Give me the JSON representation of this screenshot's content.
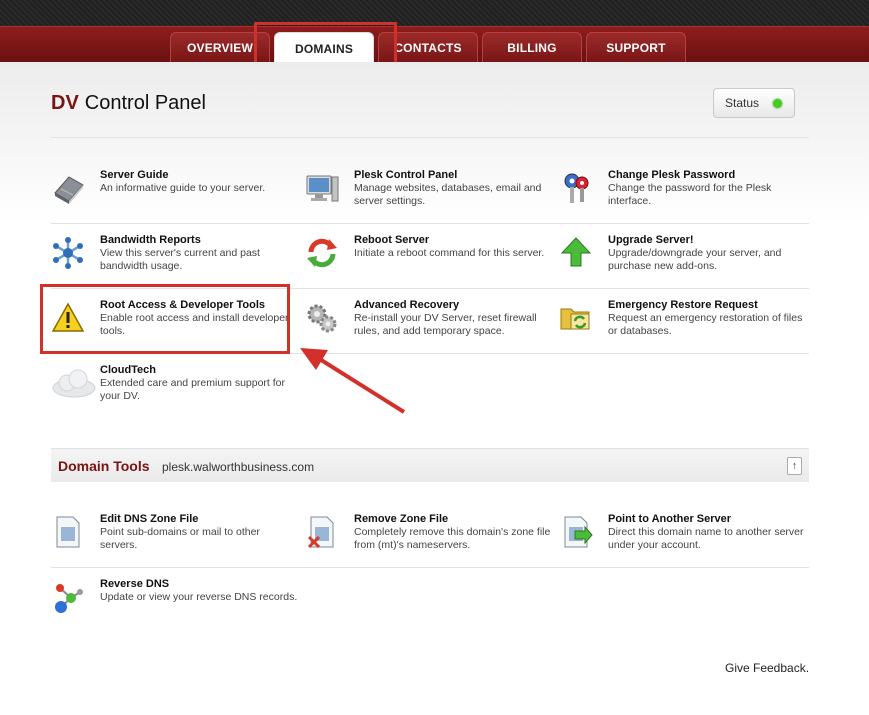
{
  "nav": {
    "tabs": [
      {
        "label": "OVERVIEW"
      },
      {
        "label": "DOMAINS"
      },
      {
        "label": "CONTACTS"
      },
      {
        "label": "BILLING"
      },
      {
        "label": "SUPPORT"
      }
    ],
    "active": "DOMAINS"
  },
  "header": {
    "title_prefix": "DV",
    "title": "Control Panel",
    "status_label": "Status",
    "status_color": "#44cc22"
  },
  "server_tools": [
    {
      "title": "Server Guide",
      "desc": "An informative guide to your server.",
      "icon": "book-icon"
    },
    {
      "title": "Plesk Control Panel",
      "desc": "Manage websites, databases, email and server settings.",
      "icon": "computer-icon"
    },
    {
      "title": "Change Plesk Password",
      "desc": "Change the password for the Plesk interface.",
      "icon": "keys-icon"
    },
    {
      "title": "Bandwidth Reports",
      "desc": "View this server's current and past bandwidth usage.",
      "icon": "network-icon"
    },
    {
      "title": "Reboot Server",
      "desc": "Initiate a reboot command for this server.",
      "icon": "reboot-icon"
    },
    {
      "title": "Upgrade Server!",
      "desc": "Upgrade/downgrade your server, and purchase new add-ons.",
      "icon": "upgrade-arrow-icon"
    },
    {
      "title": "Root Access & Developer Tools",
      "desc": "Enable root access and install developer tools.",
      "icon": "warning-icon"
    },
    {
      "title": "Advanced Recovery",
      "desc": "Re-install your DV Server, reset firewall rules, and add temporary space.",
      "icon": "gears-icon"
    },
    {
      "title": "Emergency Restore Request",
      "desc": "Request an emergency restoration of files or databases.",
      "icon": "folder-restore-icon"
    },
    {
      "title": "CloudTech",
      "desc": "Extended care and premium support for your DV.",
      "icon": "cloud-icon"
    }
  ],
  "domain_tools": {
    "title": "Domain Tools",
    "domain": "plesk.walworthbusiness.com",
    "items": [
      {
        "title": "Edit DNS Zone File",
        "desc": "Point sub-domains or mail to other servers.",
        "icon": "document-icon"
      },
      {
        "title": "Remove Zone File",
        "desc": "Completely remove this domain's zone file from (mt)'s nameservers.",
        "icon": "document-remove-icon"
      },
      {
        "title": "Point to Another Server",
        "desc": "Direct this domain name to another server under your account.",
        "icon": "document-arrow-icon"
      },
      {
        "title": "Reverse DNS",
        "desc": "Update or view your reverse DNS records.",
        "icon": "molecule-icon"
      }
    ]
  },
  "footer": {
    "feedback": "Give Feedback."
  }
}
